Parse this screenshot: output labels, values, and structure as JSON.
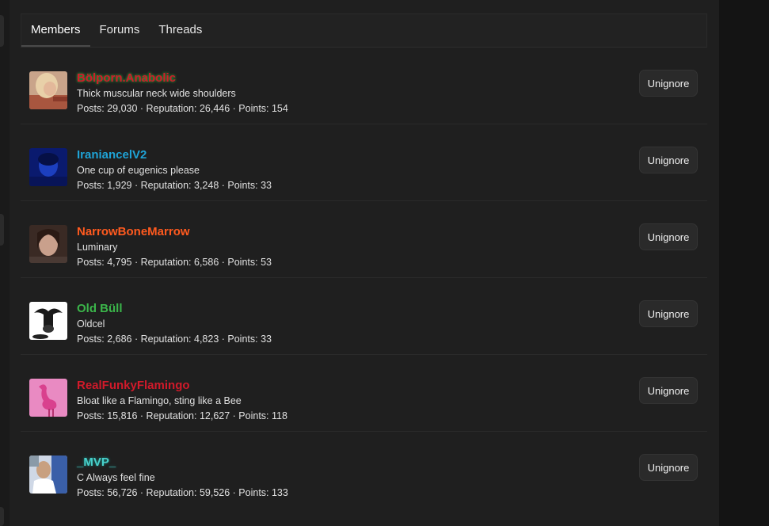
{
  "tabs": [
    {
      "label": "Members",
      "active": true
    },
    {
      "label": "Forums",
      "active": false
    },
    {
      "label": "Threads",
      "active": false
    }
  ],
  "colors": {
    "user1": "#d11a2a",
    "user2": "#1fa3d6",
    "user3": "#ff5a1f",
    "user4": "#3bb54a",
    "user5": "#d11a2a",
    "user6": "#48d1cc"
  },
  "members": [
    {
      "name": "Bölporn.Anabolic",
      "title": "Thick muscular neck wide shoulders",
      "stats": "Posts: 29,030 · Reputation: 26,446 · Points: 154",
      "button": "Unignore",
      "avatar": "blonde-woman-avatar"
    },
    {
      "name": "IraniancelV2",
      "title": "One cup of eugenics please",
      "stats": "Posts: 1,929 · Reputation: 3,248 · Points: 33",
      "button": "Unignore",
      "avatar": "blue-portrait-avatar"
    },
    {
      "name": "NarrowBoneMarrow",
      "title": "Luminary",
      "stats": "Posts: 4,795 · Reputation: 6,586 · Points: 53",
      "button": "Unignore",
      "avatar": "woman-face-avatar"
    },
    {
      "name": "Old Büll",
      "title": "Oldcel",
      "stats": "Posts: 2,686 · Reputation: 4,823 · Points: 33",
      "button": "Unignore",
      "avatar": "bull-avatar"
    },
    {
      "name": "RealFunkyFlamingo",
      "title": "Bloat like a Flamingo, sting like a Bee",
      "stats": "Posts: 15,816 · Reputation: 12,627 · Points: 118",
      "button": "Unignore",
      "avatar": "flamingo-avatar"
    },
    {
      "name": "_MVP_",
      "title": "C Always feel fine",
      "stats": "Posts: 56,726 · Reputation: 59,526 · Points: 133",
      "button": "Unignore",
      "avatar": "man-photo-avatar"
    }
  ]
}
